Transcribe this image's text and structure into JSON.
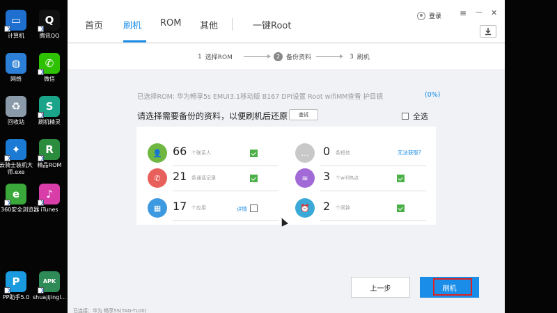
{
  "desktop": {
    "icons": [
      {
        "label": "计算机",
        "icon": "computer-icon",
        "color": "#1e6fd0"
      },
      {
        "label": "腾讯QQ",
        "icon": "qq-icon",
        "color": "#111111"
      },
      {
        "label": "网络",
        "icon": "network-icon",
        "color": "#2b7fd6"
      },
      {
        "label": "微信",
        "icon": "wechat-icon",
        "color": "#2dc100"
      },
      {
        "label": "回收站",
        "icon": "recycle-bin-icon",
        "color": "#8a9aa8"
      },
      {
        "label": "刷机精灵",
        "icon": "shuaji-jingling-icon",
        "color": "#1aa58a"
      },
      {
        "label": "云骑士装机大师.exe",
        "icon": "yunqishi-icon",
        "color": "#1b7ad4"
      },
      {
        "label": "精品ROM",
        "icon": "rom-icon",
        "color": "#2a8c3c"
      },
      {
        "label": "360安全浏览器",
        "icon": "360-browser-icon",
        "color": "#3aa83a"
      },
      {
        "label": "iTunes",
        "icon": "itunes-icon",
        "color": "#d93da8"
      },
      {
        "label": "PP助手5.0",
        "icon": "pp-assistant-icon",
        "color": "#1a9be0"
      },
      {
        "label": "shuajijingl...",
        "icon": "apk-icon",
        "color": "#2e8b57"
      }
    ]
  },
  "app": {
    "tabs": [
      "首页",
      "刷机",
      "ROM",
      "其他",
      "一键Root"
    ],
    "active_tab": "刷机",
    "login_label": "登录",
    "menu_glyph": "≡",
    "minimize_glyph": "—",
    "close_glyph": "✕",
    "accent_color": "#1a8de8",
    "steps": [
      {
        "num": "1",
        "label": "选择ROM"
      },
      {
        "num": "2",
        "label": "备份资料"
      },
      {
        "num": "3",
        "label": "刷机"
      }
    ],
    "active_step": "2",
    "rom_line": "已选择ROM:  华为畅享5s EMUI3.1移动版 B167 DPI设置 Root wifiMM查看 护目镜",
    "rom_percent": "(0%)",
    "prompt": "请选择需要备份的资料，以便刷机后还原",
    "query_button": "查试",
    "select_all": "全选",
    "items": [
      {
        "count": "66",
        "label": "个联系人",
        "icon": "contacts-icon",
        "color": "#6fb740",
        "checked": true
      },
      {
        "count": "0",
        "label": "条短信",
        "icon": "sms-icon",
        "color": "#c8c8c8",
        "checked": false,
        "link": "无法获取?"
      },
      {
        "count": "21",
        "label": "条通话记录",
        "icon": "phone-icon",
        "color": "#e8605c",
        "checked": true
      },
      {
        "count": "3",
        "label": "个wifi热点",
        "icon": "wifi-icon",
        "color": "#a16ad6",
        "checked": true
      },
      {
        "count": "17",
        "label": "个应用",
        "icon": "apps-icon",
        "color": "#3e9ae0",
        "checked": false,
        "link": "详情"
      },
      {
        "count": "2",
        "label": "个闹钟",
        "icon": "alarm-icon",
        "color": "#3aa9d8",
        "checked": true
      }
    ],
    "prev_button": "上一步",
    "flash_button": "刷机",
    "status": "已连接：华为 畅享5S(TAG-TL00)"
  }
}
